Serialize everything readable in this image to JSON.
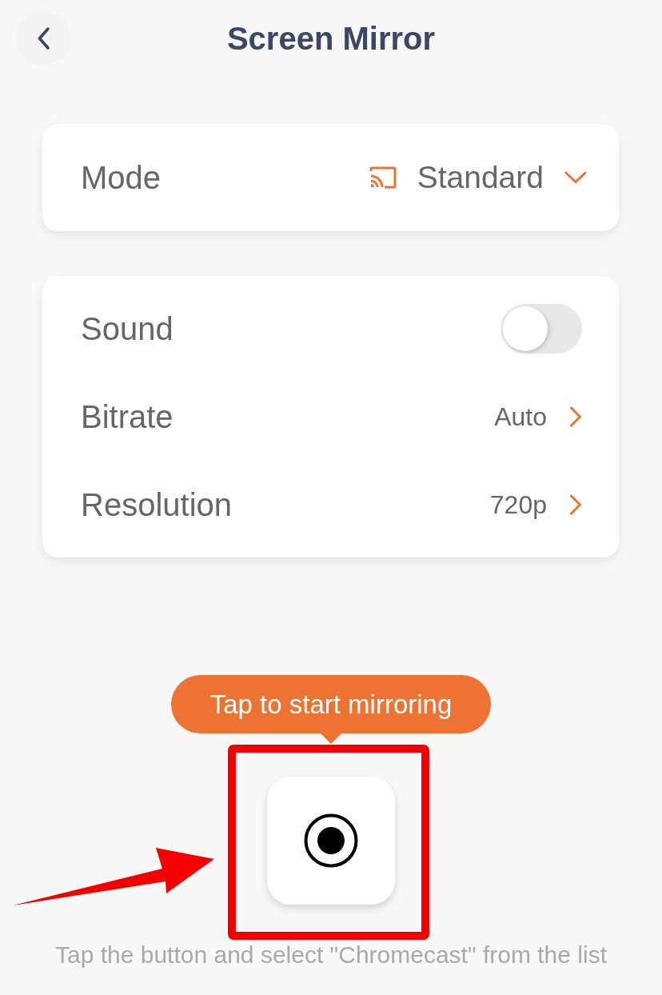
{
  "header": {
    "title": "Screen Mirror"
  },
  "mode_card": {
    "label": "Mode",
    "value": "Standard"
  },
  "settings": [
    {
      "kind": "toggle",
      "label": "Sound",
      "on": false
    },
    {
      "kind": "link",
      "label": "Bitrate",
      "value": "Auto"
    },
    {
      "kind": "link",
      "label": "Resolution",
      "value": "720p"
    }
  ],
  "tooltip": {
    "text": "Tap to start mirroring"
  },
  "record_button": {
    "highlighted": true
  },
  "caption": "Tap the button and select \"Chromecast\" from the list"
}
